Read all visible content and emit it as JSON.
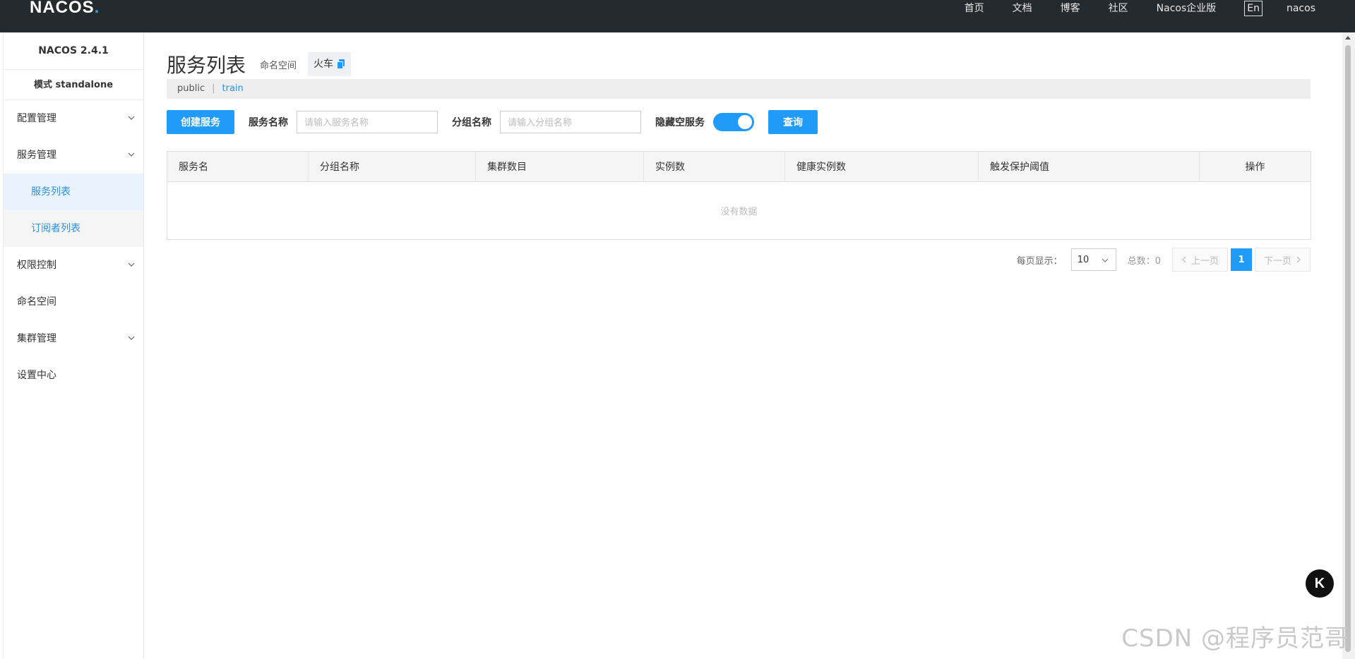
{
  "topbar": {
    "logo": "NACOS",
    "logo_dot": ".",
    "nav": [
      "首页",
      "文档",
      "博客",
      "社区",
      "Nacos企业版"
    ],
    "lang": "En",
    "user": "nacos"
  },
  "sidebar": {
    "version": "NACOS 2.4.1",
    "mode": "模式 standalone",
    "items": [
      {
        "label": "配置管理",
        "expandable": true
      },
      {
        "label": "服务管理",
        "expandable": true
      },
      {
        "label": "服务列表"
      },
      {
        "label": "订阅者列表"
      },
      {
        "label": "权限控制",
        "expandable": true
      },
      {
        "label": "命名空间",
        "expandable": false
      },
      {
        "label": "集群管理",
        "expandable": true
      },
      {
        "label": "设置中心",
        "expandable": false
      }
    ]
  },
  "main": {
    "title": "服务列表",
    "namespace_label": "命名空间",
    "namespace_current": "火车",
    "ns_bar": {
      "public": "public",
      "separator": "|",
      "train": "train"
    },
    "filters": {
      "create_button": "创建服务",
      "service_name_label": "服务名称",
      "service_name_placeholder": "请输入服务名称",
      "group_name_label": "分组名称",
      "group_name_placeholder": "请输入分组名称",
      "hide_empty_label": "隐藏空服务",
      "hide_empty_on": true,
      "query_button": "查询"
    },
    "table": {
      "columns": [
        "服务名",
        "分组名称",
        "集群数目",
        "实例数",
        "健康实例数",
        "触发保护阈值",
        "操作"
      ],
      "empty_text": "没有数据"
    },
    "pager": {
      "per_page_label": "每页显示：",
      "per_page_value": "10",
      "total_label": "总数：0",
      "prev": "上一页",
      "current": "1",
      "next": "下一页"
    }
  },
  "float_button": "K",
  "watermark": "CSDN @程序员范哥",
  "colors": {
    "accent": "#209bfa",
    "topbar": "#252a2f",
    "link": "#2c8fe0"
  }
}
